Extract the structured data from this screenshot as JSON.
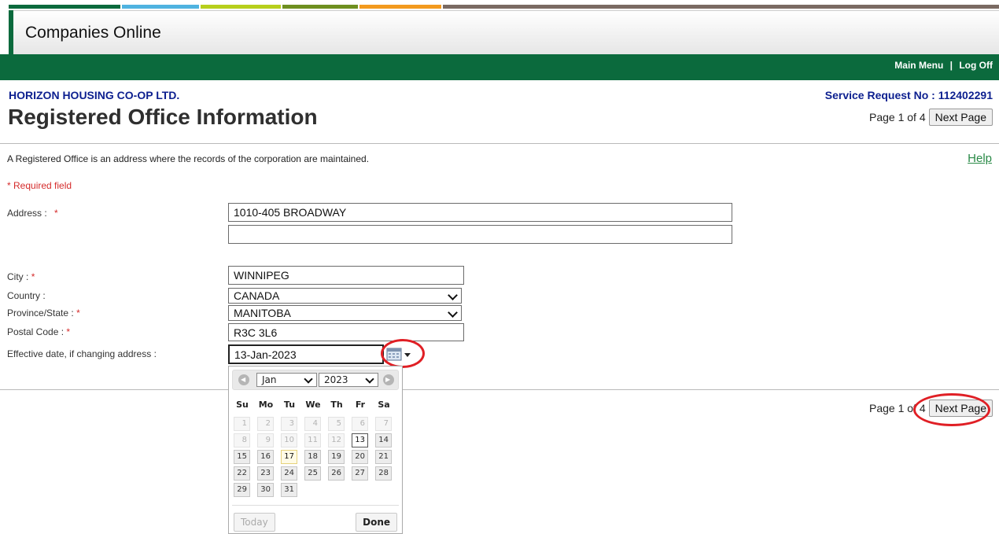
{
  "app": {
    "title": "Companies Online"
  },
  "header": {
    "main_menu": "Main Menu",
    "separator": "|",
    "log_off": "Log Off"
  },
  "accent_colors": [
    "#0b6a3d",
    "#4fb3e0",
    "#b7cf1c",
    "#6e8f1f",
    "#f39a1e",
    "#7a6a62"
  ],
  "page": {
    "organization": "HORIZON HOUSING CO-OP LTD.",
    "title": "Registered Office Information",
    "service_request": "Service Request No : 112402291",
    "page_info": "Page 1 of 4",
    "next_page": "Next Page",
    "description": "A Registered Office is an address where the records of the corporation are maintained.",
    "help": "Help",
    "required_note": "* Required field"
  },
  "form": {
    "address_label": "Address :",
    "address_line1": "1010-405 BROADWAY",
    "address_line2": "",
    "city_label": "City :",
    "city": "WINNIPEG",
    "country_label": "Country :",
    "country": "CANADA",
    "province_label": "Province/State :",
    "province": "MANITOBA",
    "postal_label": "Postal Code :",
    "postal": "R3C 3L6",
    "effective_label": "Effective date, if changing address :",
    "effective_date": "13-Jan-2023",
    "required_marker": "*"
  },
  "datepicker": {
    "month": "Jan",
    "year": "2023",
    "weekdays": [
      "Su",
      "Mo",
      "Tu",
      "We",
      "Th",
      "Fr",
      "Sa"
    ],
    "days": [
      "1",
      "2",
      "3",
      "4",
      "5",
      "6",
      "7",
      "8",
      "9",
      "10",
      "11",
      "12",
      "13",
      "14",
      "15",
      "16",
      "17",
      "18",
      "19",
      "20",
      "21",
      "22",
      "23",
      "24",
      "25",
      "26",
      "27",
      "28",
      "29",
      "30",
      "31"
    ],
    "selected_day": 13,
    "today_day": 17,
    "today_button": "Today",
    "done_button": "Done"
  },
  "footer": {
    "page_info": "Page 1 of 4",
    "next_page": "Next Page"
  }
}
